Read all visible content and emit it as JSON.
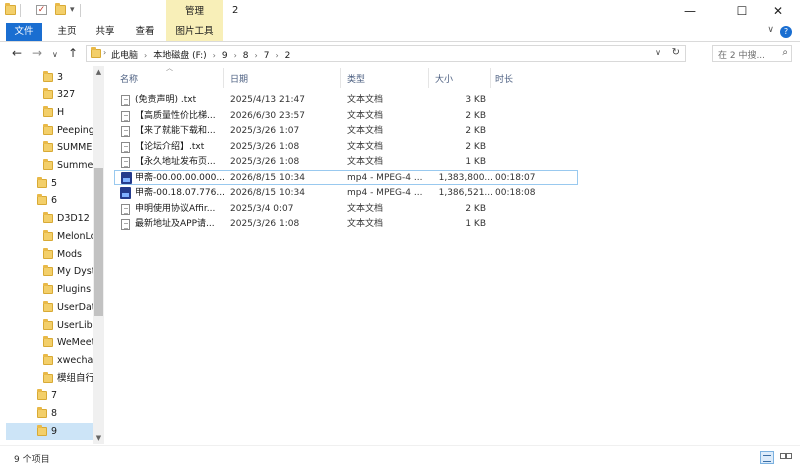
{
  "window": {
    "title": "2",
    "context_tab_top": "管理",
    "minimize": "—",
    "maximize": "☐",
    "close": "✕"
  },
  "ribbon": {
    "tabs": [
      "文件",
      "主页",
      "共享",
      "查看"
    ],
    "context_tab": "图片工具",
    "help": "?"
  },
  "address": {
    "crumbs": [
      "此电脑",
      "本地磁盘 (F:)",
      "9",
      "8",
      "7",
      "2"
    ],
    "search_placeholder": "在 2 中搜...",
    "nav": {
      "back": "←",
      "forward": "→",
      "dropdown": "∨",
      "up": "↑"
    }
  },
  "columns": {
    "name": "名称",
    "date": "日期",
    "type": "类型",
    "size": "大小",
    "duration": "时长"
  },
  "files": [
    {
      "name": "(免责声明) .txt",
      "date": "2025/4/13 21:47",
      "type": "文本文档",
      "size": "3 KB",
      "duration": "",
      "icon": "txt"
    },
    {
      "name": "【高质量性价比梯...",
      "date": "2026/6/30 23:57",
      "type": "文本文档",
      "size": "2 KB",
      "duration": "",
      "icon": "txt"
    },
    {
      "name": "【来了就能下载和...",
      "date": "2025/3/26 1:07",
      "type": "文本文档",
      "size": "2 KB",
      "duration": "",
      "icon": "txt"
    },
    {
      "name": "【论坛介绍】.txt",
      "date": "2025/3/26 1:08",
      "type": "文本文档",
      "size": "2 KB",
      "duration": "",
      "icon": "txt"
    },
    {
      "name": "【永久地址发布页...",
      "date": "2025/3/26 1:08",
      "type": "文本文档",
      "size": "1 KB",
      "duration": "",
      "icon": "txt"
    },
    {
      "name": "甲斋-00.00.00.000...",
      "date": "2026/8/15 10:34",
      "type": "mp4 - MPEG-4 ...",
      "size": "1,383,800...",
      "duration": "00:18:07",
      "icon": "mp4"
    },
    {
      "name": "甲斋-00.18.07.776...",
      "date": "2026/8/15 10:34",
      "type": "mp4 - MPEG-4 ...",
      "size": "1,386,521...",
      "duration": "00:18:08",
      "icon": "mp4"
    },
    {
      "name": "申明使用协议Affir...",
      "date": "2025/3/4 0:07",
      "type": "文本文档",
      "size": "2 KB",
      "duration": "",
      "icon": "txt"
    },
    {
      "name": "最新地址及APP请...",
      "date": "2025/3/26 1:08",
      "type": "文本文档",
      "size": "1 KB",
      "duration": "",
      "icon": "txt"
    }
  ],
  "nav_tree": [
    {
      "label": "3"
    },
    {
      "label": "327"
    },
    {
      "label": "H"
    },
    {
      "label": "Peeping"
    },
    {
      "label": "SUMME"
    },
    {
      "label": "Summer"
    },
    {
      "label": "5"
    },
    {
      "label": "6"
    },
    {
      "label": "D3D12"
    },
    {
      "label": "MelonLo"
    },
    {
      "label": "Mods"
    },
    {
      "label": "My Dyst"
    },
    {
      "label": "Plugins"
    },
    {
      "label": "UserDat"
    },
    {
      "label": "UserLibs"
    },
    {
      "label": "WeMeet"
    },
    {
      "label": "xwechat"
    },
    {
      "label": "模组自行"
    },
    {
      "label": "7"
    },
    {
      "label": "8"
    },
    {
      "label": "9"
    }
  ],
  "status": {
    "item_count": "9 个项目"
  },
  "colors": {
    "accent": "#1a6ed1",
    "context_tab": "#f8efb8",
    "selection": "#cce4f7"
  }
}
